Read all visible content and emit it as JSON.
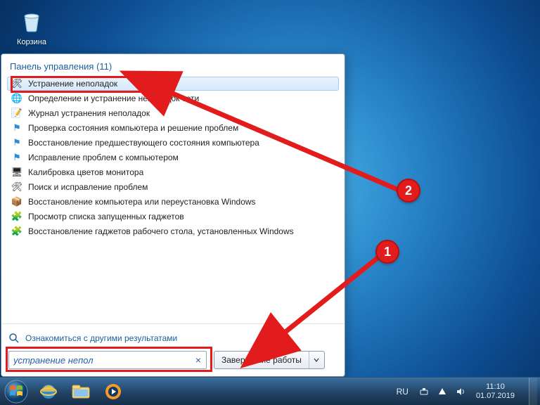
{
  "desktop": {
    "recycle_bin": "Корзина"
  },
  "start_menu": {
    "header": {
      "section": "Панель управления",
      "count": "(11)"
    },
    "results": [
      {
        "label": "Устранение неполадок",
        "icon": "troubleshoot-icon",
        "selected": true
      },
      {
        "label": "Определение и устранение неполадок сети",
        "icon": "network-icon"
      },
      {
        "label": "Журнал устранения неполадок",
        "icon": "history-icon"
      },
      {
        "label": "Проверка состояния компьютера и решение проблем",
        "icon": "flag-icon"
      },
      {
        "label": "Восстановление предшествующего состояния компьютера",
        "icon": "flag-icon"
      },
      {
        "label": "Исправление проблем с компьютером",
        "icon": "flag-icon"
      },
      {
        "label": "Калибровка цветов монитора",
        "icon": "monitor-icon"
      },
      {
        "label": "Поиск и исправление проблем",
        "icon": "troubleshoot-icon"
      },
      {
        "label": "Восстановление компьютера или переустановка Windows",
        "icon": "restore-icon"
      },
      {
        "label": "Просмотр списка запущенных гаджетов",
        "icon": "gadgets-icon"
      },
      {
        "label": "Восстановление гаджетов рабочего стола, установленных Windows",
        "icon": "gadgets-icon"
      }
    ],
    "see_more": "Ознакомиться с другими результатами",
    "search": {
      "value": "устранение непол",
      "clear_symbol": "×"
    },
    "shutdown": {
      "label": "Завершение работы"
    }
  },
  "annotations": {
    "badge1": "1",
    "badge2": "2",
    "color": "#e21c1c"
  },
  "taskbar": {
    "language": "RU",
    "time": "11:10",
    "date": "01.07.2019"
  },
  "icons": {
    "troubleshoot-icon": "🛠",
    "network-icon": "🌐",
    "history-icon": "📝",
    "flag-icon": "⚑",
    "monitor-icon": "🖥",
    "restore-icon": "📦",
    "gadgets-icon": "🧩"
  }
}
